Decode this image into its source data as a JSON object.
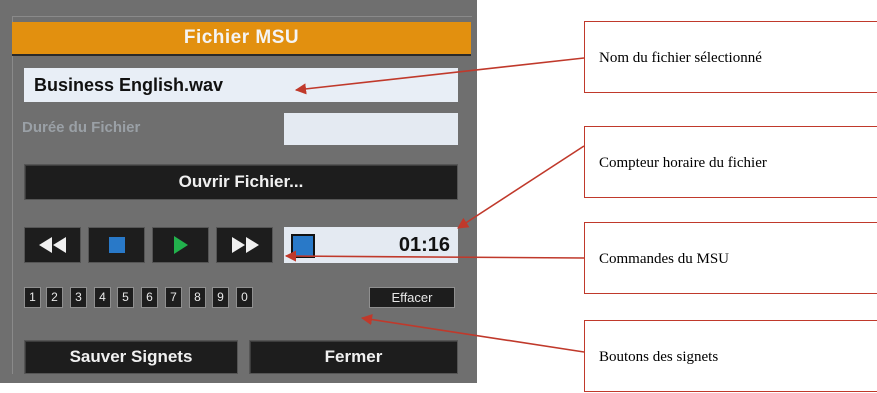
{
  "panel": {
    "title": "Fichier MSU",
    "filename": "Business English.wav",
    "duration_label": "Durée du Fichier",
    "open_button": "Ouvrir Fichier...",
    "counter_time": "01:16",
    "bookmarks": [
      "1",
      "2",
      "3",
      "4",
      "5",
      "6",
      "7",
      "8",
      "9",
      "0"
    ],
    "clear_button": "Effacer",
    "save_button": "Sauver Signets",
    "close_button": "Fermer",
    "colors": {
      "title_bar": "#e2900f",
      "panel_bg": "#6f6f6f",
      "play_icon": "#22b14c",
      "stop_icon": "#2979c8"
    },
    "icons": [
      "rewind-icon",
      "stop-icon",
      "play-icon",
      "fast-forward-icon"
    ]
  },
  "callouts": {
    "filename": "Nom du fichier sélectionné",
    "counter": "Compteur horaire du fichier",
    "controls": "Commandes du MSU",
    "bookmarks": "Boutons des signets"
  },
  "colors": {
    "callout_line": "#c0392b"
  }
}
